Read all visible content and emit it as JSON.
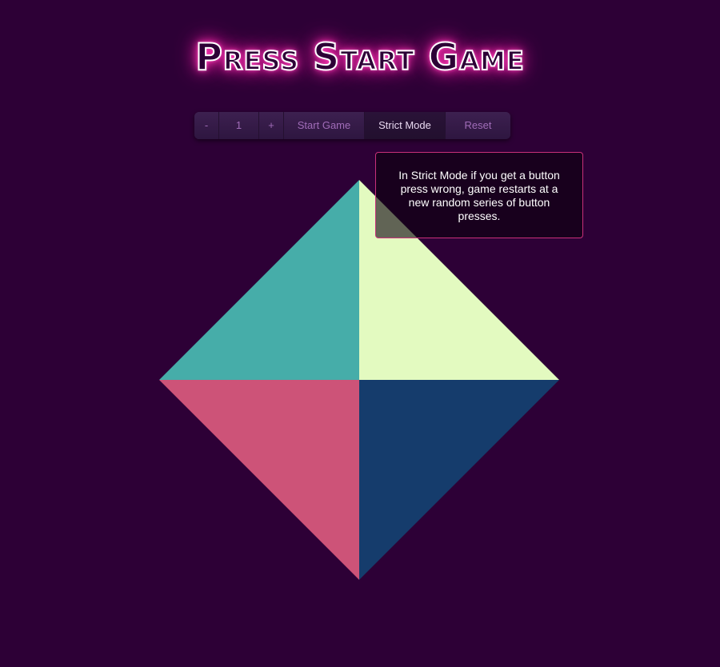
{
  "title": "Press Start Game",
  "controls": {
    "minus_label": "-",
    "count_value": "1",
    "plus_label": "+",
    "start_label": "Start Game",
    "strict_label": "Strict Mode",
    "reset_label": "Reset"
  },
  "tooltip": {
    "text": "In Strict Mode if you get a button press wrong, game restarts at a new random series of button presses."
  },
  "colors": {
    "background": "#2d0036",
    "pad_top_left": "#46ada9",
    "pad_top_right": "#e3fac0",
    "pad_bottom_left": "#cd5378",
    "pad_bottom_right": "#153c6c",
    "neon_pink": "#ff2fb0"
  }
}
